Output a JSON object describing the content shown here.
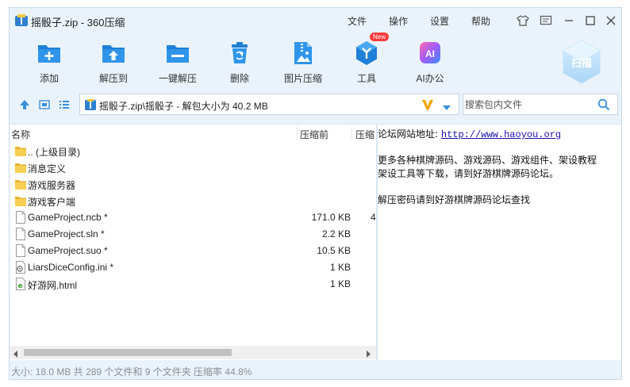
{
  "window": {
    "title": "摇骰子.zip - 360压缩",
    "menu": [
      "文件",
      "操作",
      "设置",
      "帮助"
    ]
  },
  "toolbar": {
    "items": [
      {
        "label": "添加",
        "icon": "add-icon"
      },
      {
        "label": "解压到",
        "icon": "extract-to-icon"
      },
      {
        "label": "一键解压",
        "icon": "one-click-extract-icon"
      },
      {
        "label": "删除",
        "icon": "trash-icon"
      },
      {
        "label": "图片压缩",
        "icon": "image-compress-icon"
      },
      {
        "label": "工具",
        "icon": "tools-icon",
        "badge": "New"
      },
      {
        "label": "AI办公",
        "icon": "ai-office-icon",
        "icon_text": "AI"
      }
    ],
    "scan_label": "扫描"
  },
  "address": {
    "path": "摇骰子.zip\\摇骰子 - 解包大小为 40.2 MB"
  },
  "search": {
    "placeholder": "搜索包内文件"
  },
  "filelist": {
    "columns": [
      "名称",
      "压缩前",
      "压缩"
    ],
    "rows": [
      {
        "name": ".. (上级目录)",
        "size": "",
        "type": "folder",
        "extra": ""
      },
      {
        "name": "消息定义",
        "size": "",
        "type": "folder",
        "extra": ""
      },
      {
        "name": "游戏服务器",
        "size": "",
        "type": "folder",
        "extra": ""
      },
      {
        "name": "游戏客户端",
        "size": "",
        "type": "folder",
        "extra": ""
      },
      {
        "name": "GameProject.ncb *",
        "size": "171.0 KB",
        "type": "file",
        "extra": "4"
      },
      {
        "name": "GameProject.sln *",
        "size": "2.2 KB",
        "type": "file",
        "extra": ""
      },
      {
        "name": "GameProject.suo *",
        "size": "10.5 KB",
        "type": "file",
        "extra": ""
      },
      {
        "name": "LiarsDiceConfig.ini *",
        "size": "1 KB",
        "type": "ini",
        "extra": ""
      },
      {
        "name": "好游网.html",
        "size": "1 KB",
        "type": "html",
        "extra": ""
      }
    ]
  },
  "comment": {
    "site_label": "论坛网站地址:",
    "site_url": "http://www.haoyou.org",
    "line2": "更多各种棋牌源码、游戏源码、游戏组件、架设教程",
    "line3": "架设工具等下载，请到好游棋牌源码论坛。",
    "line4": "解压密码请到好游棋牌源码论坛查找"
  },
  "status": {
    "text": "大小: 18.0 MB 共 289 个文件和 9 个文件夹 压缩率 44.8%"
  },
  "colors": {
    "accent": "#1f7fd6",
    "window_bg": "#eaf3fb",
    "folder": "#f5c93e",
    "link": "#1a0dab"
  }
}
